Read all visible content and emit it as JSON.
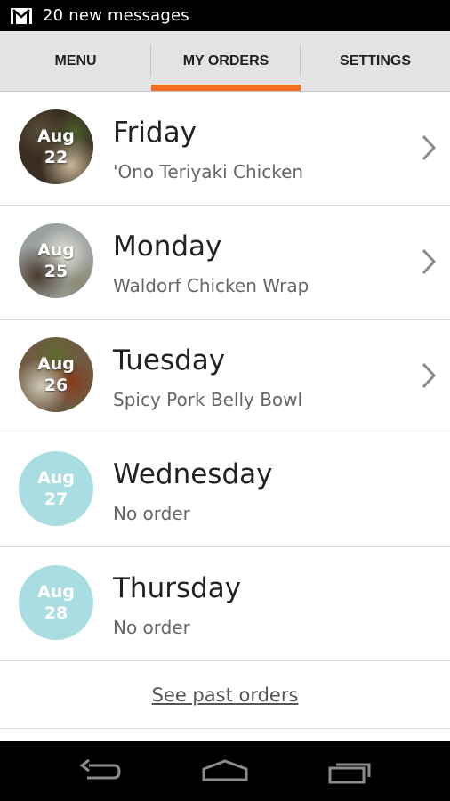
{
  "status_bar": {
    "notification_icon": "gmail-icon",
    "notification_text": "20 new messages"
  },
  "tabs": [
    {
      "label": "MENU",
      "active": false
    },
    {
      "label": "MY ORDERS",
      "active": true
    },
    {
      "label": "SETTINGS",
      "active": false
    }
  ],
  "accent_color": "#f36c21",
  "empty_badge_color": "#a8dde1",
  "orders": [
    {
      "month": "Aug",
      "date": "22",
      "day": "Friday",
      "item": "'Ono Teriyaki Chicken",
      "has_photo": true,
      "chevron": true
    },
    {
      "month": "Aug",
      "date": "25",
      "day": "Monday",
      "item": "Waldorf Chicken Wrap",
      "has_photo": true,
      "chevron": true
    },
    {
      "month": "Aug",
      "date": "26",
      "day": "Tuesday",
      "item": "Spicy Pork Belly Bowl",
      "has_photo": true,
      "chevron": true
    },
    {
      "month": "Aug",
      "date": "27",
      "day": "Wednesday",
      "item": "No order",
      "has_photo": false,
      "chevron": false
    },
    {
      "month": "Aug",
      "date": "28",
      "day": "Thursday",
      "item": "No order",
      "has_photo": false,
      "chevron": false
    }
  ],
  "past_orders_link": "See past orders",
  "nav_bar": {
    "back_icon": "back-icon",
    "home_icon": "home-icon",
    "recents_icon": "recent-apps-icon"
  }
}
